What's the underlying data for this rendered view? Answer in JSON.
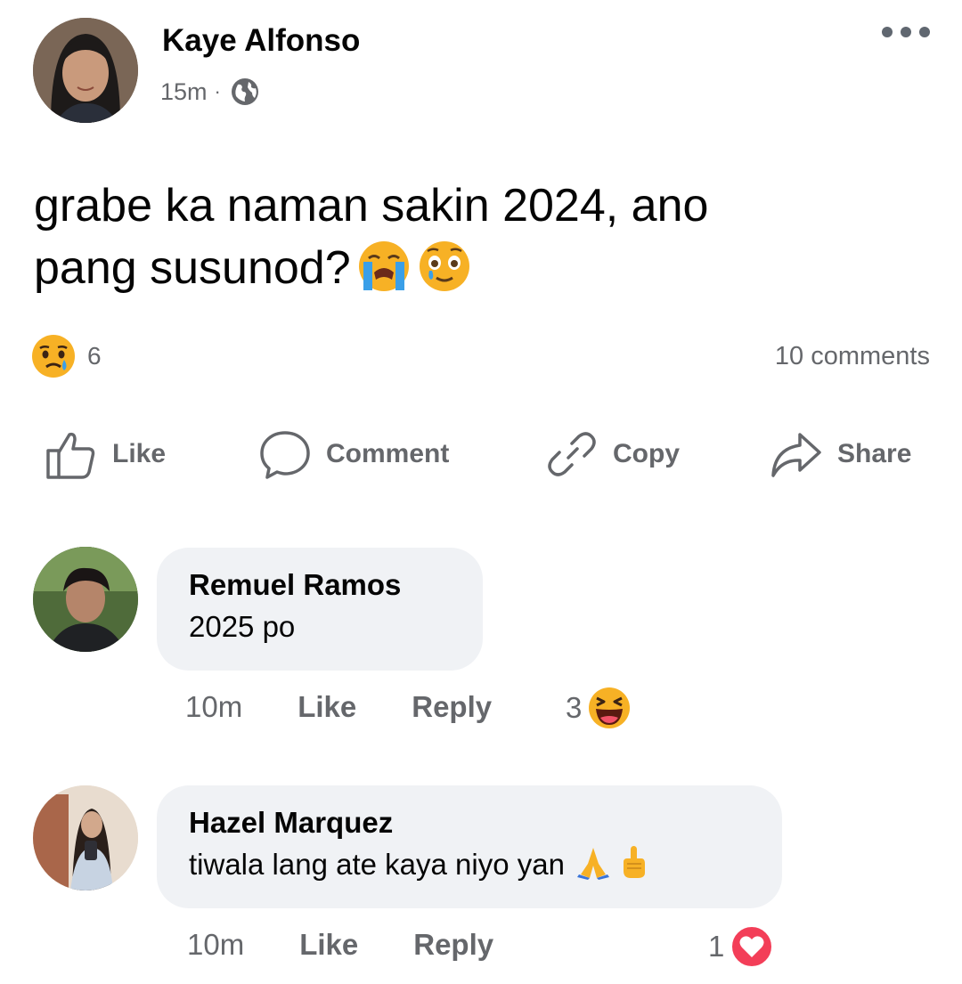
{
  "post": {
    "author": "Kaye Alfonso",
    "time": "15m",
    "separator": "·",
    "privacy_icon": "globe-icon",
    "text_line1": "grabe ka naman sakin 2024, ano",
    "text_line2": "pang susunod?",
    "emojis": [
      "loudly-crying-face",
      "face-holding-back-tears"
    ],
    "reaction_icon": "sad-reaction",
    "reaction_count": "6",
    "comments_count": "10 comments"
  },
  "actions": {
    "like": "Like",
    "comment": "Comment",
    "copy": "Copy",
    "share": "Share"
  },
  "comments": [
    {
      "name": "Remuel Ramos",
      "text": "2025 po",
      "time": "10m",
      "like": "Like",
      "reply": "Reply",
      "reaction_count": "3",
      "reaction_icon": "haha-reaction"
    },
    {
      "name": "Hazel Marquez",
      "text": "tiwala lang ate kaya niyo yan",
      "text_emojis": [
        "folded-hands",
        "index-pointing-up"
      ],
      "time": "10m",
      "like": "Like",
      "reply": "Reply",
      "reaction_count": "1",
      "reaction_icon": "love-reaction"
    }
  ],
  "colors": {
    "text": "#050505",
    "muted": "#65676b",
    "bubble": "#f0f2f5",
    "love": "#f33e58",
    "emoji_yellow": "#f7b125"
  }
}
